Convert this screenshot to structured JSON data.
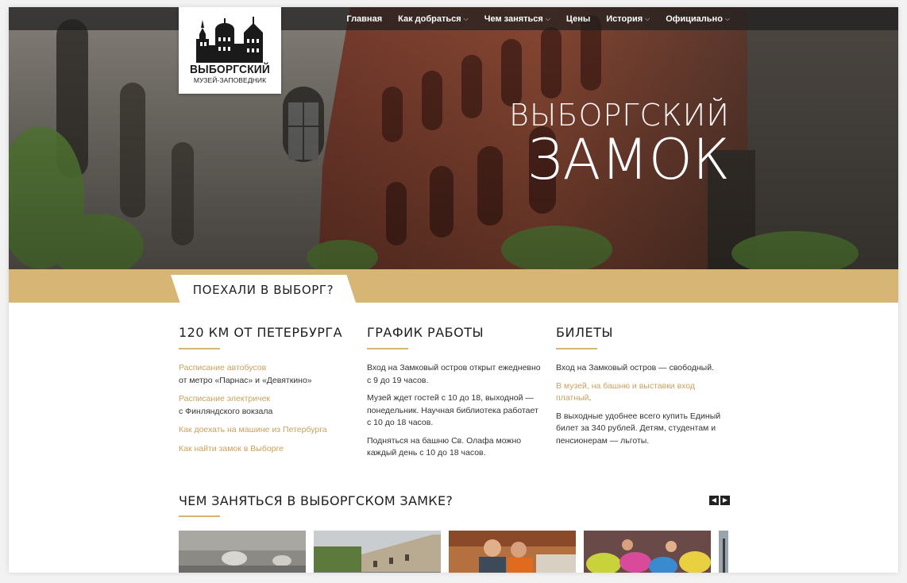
{
  "nav": {
    "items": [
      {
        "label": "Главная",
        "dropdown": false
      },
      {
        "label": "Как добраться",
        "dropdown": true
      },
      {
        "label": "Чем заняться",
        "dropdown": true
      },
      {
        "label": "Цены",
        "dropdown": false
      },
      {
        "label": "История",
        "dropdown": true
      },
      {
        "label": "Официально",
        "dropdown": true
      }
    ]
  },
  "logo": {
    "title": "ВЫБОРГСКИЙ",
    "subtitle": "МУЗЕЙ-ЗАПОВЕДНИК"
  },
  "hero": {
    "line1": "ВЫБОРГСКИЙ",
    "line2": "ЗАМОК"
  },
  "band": {
    "tab_label": "ПОЕХАЛИ В ВЫБОРГ?"
  },
  "columns": {
    "route": {
      "title": "120 КМ ОТ ПЕТЕРБУРГА",
      "links": [
        {
          "label": "Расписание автобусов",
          "sub": "от метро «Парнас» и «Девяткино»"
        },
        {
          "label": "Расписание электричек",
          "sub": "с Финляндского вокзала"
        },
        {
          "label": "Как доехать на машине из Петербурга",
          "sub": ""
        },
        {
          "label": "Как найти замок в Выборге",
          "sub": ""
        }
      ]
    },
    "schedule": {
      "title": "ГРАФИК РАБОТЫ",
      "p1": "Вход на Замковый остров открыт ежедневно с 9 до 19 часов.",
      "p2": "Музей ждет гостей с 10 до 18, выходной — понедельник. Научная библиотека работает с 10 до 18 часов.",
      "p3": "Подняться на башню Св. Олафа можно каждый день с 10 до 18 часов."
    },
    "tickets": {
      "title": "БИЛЕТЫ",
      "p1": "Вход на Замковый остров — свободный.",
      "link": "В музей, на башню и выставки вход платный",
      "link_tail": ".",
      "p2": "В выходные удобнее всего купить Единый билет за 340 рублей. Детям, студентам и пенсионерам — льготы."
    }
  },
  "activities": {
    "title": "ЧЕМ ЗАНЯТЬСЯ В ВЫБОРГСКОМ ЗАМКЕ?",
    "prev_icon": "arrow-left-icon",
    "next_icon": "arrow-right-icon"
  },
  "colors": {
    "accent": "#d7b574",
    "link": "#c9a15d"
  }
}
